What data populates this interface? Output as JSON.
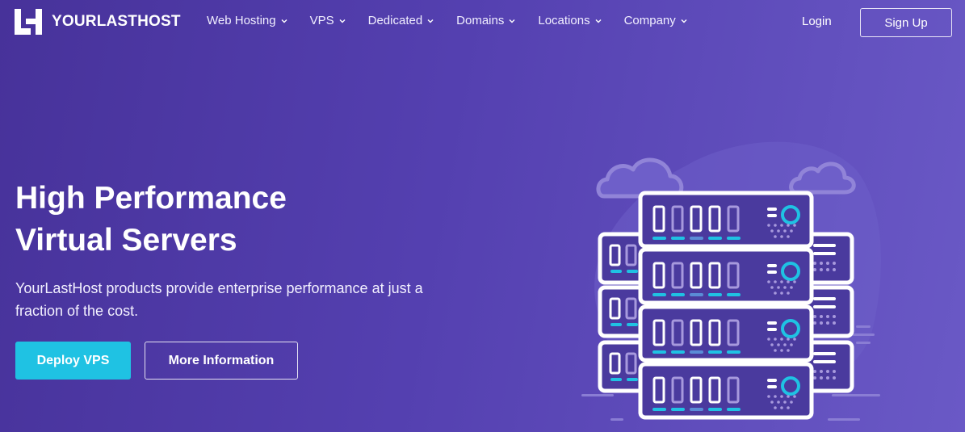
{
  "brand": {
    "name": "YOURLASTHOST",
    "logo_icon": "yl-logo-icon"
  },
  "nav": {
    "items": [
      {
        "label": "Web Hosting",
        "icon": "chevron-down-icon"
      },
      {
        "label": "VPS",
        "icon": "chevron-down-icon"
      },
      {
        "label": "Dedicated",
        "icon": "chevron-down-icon"
      },
      {
        "label": "Domains",
        "icon": "chevron-down-icon"
      },
      {
        "label": "Locations",
        "icon": "chevron-down-icon"
      },
      {
        "label": "Company",
        "icon": "chevron-down-icon"
      }
    ],
    "login_label": "Login",
    "signup_label": "Sign Up"
  },
  "hero": {
    "title_line1": "High Performance",
    "title_line2": "Virtual Servers",
    "description": "YourLastHost products provide enterprise performance at just a fraction of the cost.",
    "primary_button": "Deploy VPS",
    "secondary_button": "More Information",
    "illustration_icon": "server-rack-cloud-illustration"
  },
  "colors": {
    "background_start": "#47329a",
    "background_end": "#6a59c6",
    "accent": "#1fc2e3",
    "server_body": "#4a3a9e"
  }
}
